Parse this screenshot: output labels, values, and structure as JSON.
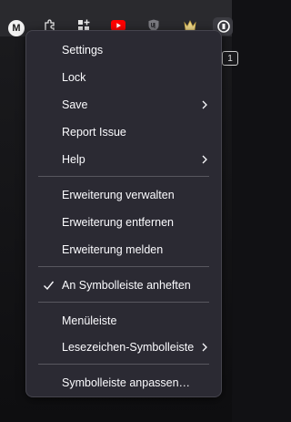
{
  "toolbar": {
    "avatar_letter": "M",
    "badge_text": "1",
    "icons": [
      "puzzle-icon",
      "grid-plus-icon",
      "youtube-icon",
      "ublock-shield-icon",
      "crown-icon",
      "extension-active-icon"
    ]
  },
  "menu": {
    "items": [
      {
        "label": "Settings",
        "submenu": false
      },
      {
        "label": "Lock",
        "submenu": false
      },
      {
        "label": "Save",
        "submenu": true
      },
      {
        "label": "Report Issue",
        "submenu": false
      },
      {
        "label": "Help",
        "submenu": true
      },
      {
        "label": "Erweiterung verwalten",
        "submenu": false
      },
      {
        "label": "Erweiterung entfernen",
        "submenu": false
      },
      {
        "label": "Erweiterung melden",
        "submenu": false
      },
      {
        "label": "An Symbolleiste anheften",
        "checked": true
      },
      {
        "label": "Menüleiste",
        "submenu": false
      },
      {
        "label": "Lesezeichen-Symbolleiste",
        "submenu": true
      },
      {
        "label": "Symbolleiste anpassen…",
        "submenu": false
      }
    ]
  },
  "colors": {
    "menu_bg": "#2b2a33",
    "menu_text": "#fbfbfe",
    "separator": "#58575f",
    "youtube_red": "#ff0000"
  }
}
